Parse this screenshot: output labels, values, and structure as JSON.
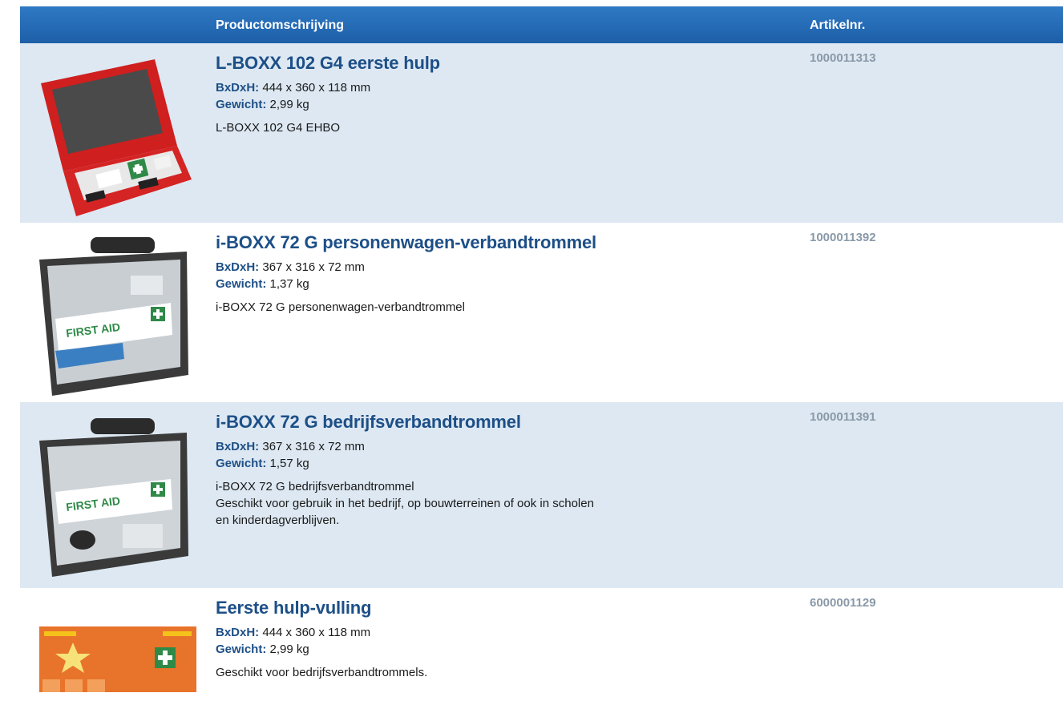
{
  "header": {
    "description_col": "Productomschrijving",
    "article_col": "Artikelnr."
  },
  "colors": {
    "header_bg": "#1d5fa8",
    "title": "#1d4f87",
    "row_shade": "#dde8f2",
    "article_number": "#8a99a8"
  },
  "labels": {
    "dimensions": "BxDxH:",
    "weight": "Gewicht:"
  },
  "products": [
    {
      "title": "L-BOXX 102 G4 eerste hulp",
      "dimensions": "444 x 360 x 118 mm",
      "weight": "2,99 kg",
      "description": [
        "L-BOXX 102 G4 EHBO"
      ],
      "article_number": "1000011313",
      "image": "red-first-aid-case-image"
    },
    {
      "title": "i-BOXX 72 G personenwagen-verbandtrommel",
      "dimensions": "367 x 316 x 72 mm",
      "weight": "1,37 kg",
      "description": [
        "i-BOXX 72 G personenwagen-verbandtrommel"
      ],
      "article_number": "1000011392",
      "image": "grey-first-aid-case-image",
      "image_text": "FIRST AID"
    },
    {
      "title": "i-BOXX 72 G bedrijfsverbandtrommel",
      "dimensions": "367 x 316 x 72 mm",
      "weight": "1,57 kg",
      "description": [
        "i-BOXX 72 G bedrijfsverbandtrommel",
        "Geschikt voor gebruik in het bedrijf, op bouwterreinen of ook in scholen",
        "en kinderdagverblijven."
      ],
      "article_number": "1000011391",
      "image": "grey-first-aid-case-image",
      "image_text": "FIRST AID"
    },
    {
      "title": "Eerste hulp-vulling",
      "dimensions": "444 x 360 x 118 mm",
      "weight": "2,99 kg",
      "description": [
        "Geschikt voor bedrijfsverbandtrommels."
      ],
      "article_number": "6000001129",
      "image": "orange-refill-pack-image"
    }
  ]
}
